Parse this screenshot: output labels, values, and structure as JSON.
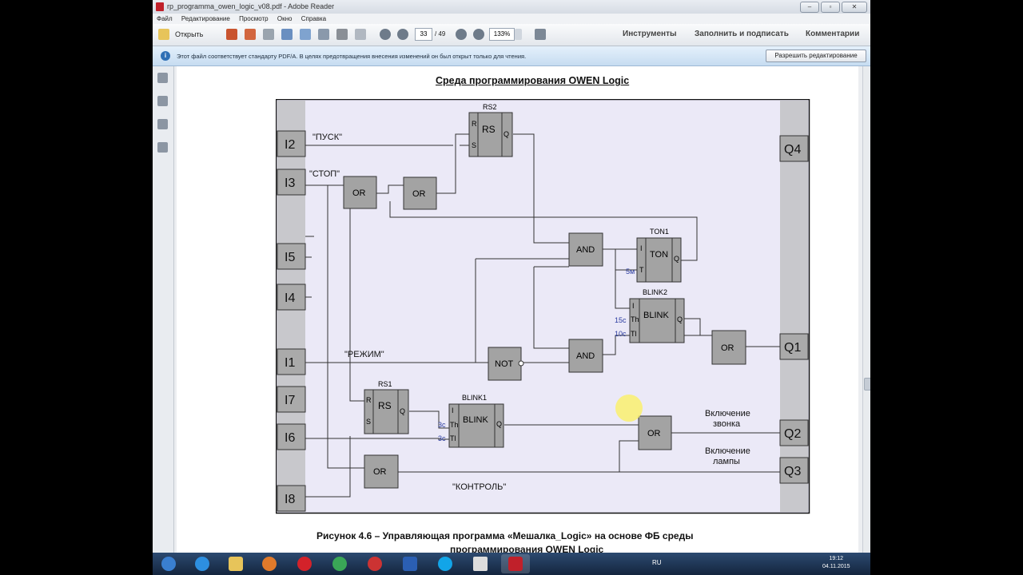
{
  "window": {
    "title": "rp_programma_owen_logic_v08.pdf - Adobe Reader",
    "controls": [
      "–",
      "▫",
      "✕"
    ]
  },
  "menu": [
    "Файл",
    "Редактирование",
    "Просмотр",
    "Окно",
    "Справка"
  ],
  "toolbar": {
    "open_label": "Открыть",
    "page_current": "33",
    "page_total": "/ 49",
    "zoom": "133%",
    "tools_label": "Инструменты",
    "fill_sign_label": "Заполнить и подписать",
    "comments_label": "Комментарии"
  },
  "infobar": {
    "message": "Этот файл соответствует стандарту PDF/A. В целях предотвращения внесения изменений он был открыт только для чтения.",
    "enable_edit_label": "Разрешить редактирование"
  },
  "document": {
    "heading": "Среда программирования OWEN Logic",
    "caption_line1": "Рисунок 4.6 – Управляющая программа «Мешалка_Logic» на основе ФБ среды",
    "caption_line2": "программирования OWEN Logic"
  },
  "diagram": {
    "inputs": [
      "I2",
      "I3",
      "I5",
      "I4",
      "I1",
      "I7",
      "I6",
      "I8"
    ],
    "outputs": [
      "Q4",
      "Q1",
      "Q2",
      "Q3"
    ],
    "labels": {
      "pusk": "\"ПУСК\"",
      "stop": "\"СТОП\"",
      "rezhim": "\"РЕЖИМ\"",
      "kontrol": "\"КОНТРОЛЬ\"",
      "zvonok1": "Включение",
      "zvonok2": "звонка",
      "lampa1": "Включение",
      "lampa2": "лампы"
    },
    "blocks": {
      "rs2_name": "RS2",
      "rs": "RS",
      "r": "R",
      "s": "S",
      "q": "Q",
      "or": "OR",
      "and": "AND",
      "not": "NOT",
      "ton1_name": "TON1",
      "ton": "TON",
      "i": "I",
      "t": "T",
      "ton_param": "5м",
      "blink2_name": "BLINK2",
      "blink": "BLINK",
      "th": "Th",
      "tl": "Tl",
      "blink2_th": "15с",
      "blink2_tl": "10с",
      "rs1_name": "RS1",
      "blink1_name": "BLINK1",
      "blink1_th": "3с",
      "blink1_tl": "3с"
    }
  },
  "taskbar": {
    "lang": "RU",
    "time": "19:12",
    "date": "04.11.2015"
  },
  "colors": {
    "diagram_bg": "#ebe9f7",
    "block_fill": "#a3a3a3",
    "rail_fill": "#c8c8cc",
    "param_text": "#2b3ca0"
  }
}
